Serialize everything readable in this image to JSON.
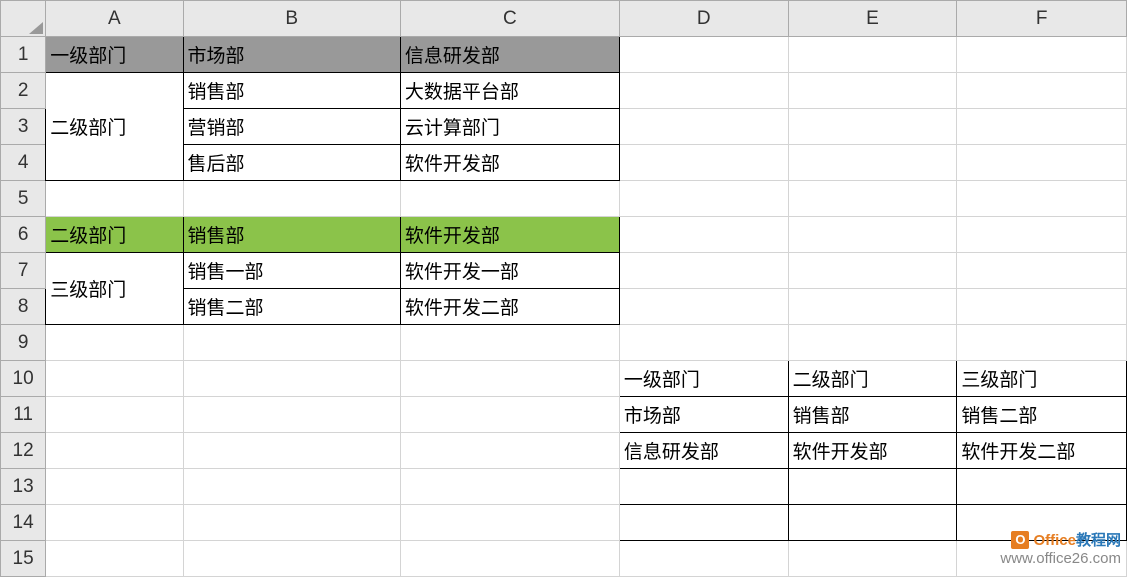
{
  "columns": [
    "A",
    "B",
    "C",
    "D",
    "E",
    "F"
  ],
  "rows": [
    "1",
    "2",
    "3",
    "4",
    "5",
    "6",
    "7",
    "8",
    "9",
    "10",
    "11",
    "12",
    "13",
    "14",
    "15"
  ],
  "cells": {
    "A1": "一级部门",
    "B1": "市场部",
    "C1": "信息研发部",
    "A2_4": "二级部门",
    "B2": "销售部",
    "C2": "大数据平台部",
    "B3": "营销部",
    "C3": "云计算部门",
    "B4": "售后部",
    "C4": "软件开发部",
    "A6": "二级部门",
    "B6": "销售部",
    "C6": "软件开发部",
    "A7_8": "三级部门",
    "B7": "销售一部",
    "C7": "软件开发一部",
    "B8": "销售二部",
    "C8": "软件开发二部",
    "D10": "一级部门",
    "E10": "二级部门",
    "F10": "三级部门",
    "D11": "市场部",
    "E11": "销售部",
    "F11": "销售二部",
    "D12": "信息研发部",
    "E12": "软件开发部",
    "F12": "软件开发二部"
  },
  "watermark": {
    "brand1": "Office",
    "brand2": "教程网",
    "url": "www.office26.com"
  }
}
